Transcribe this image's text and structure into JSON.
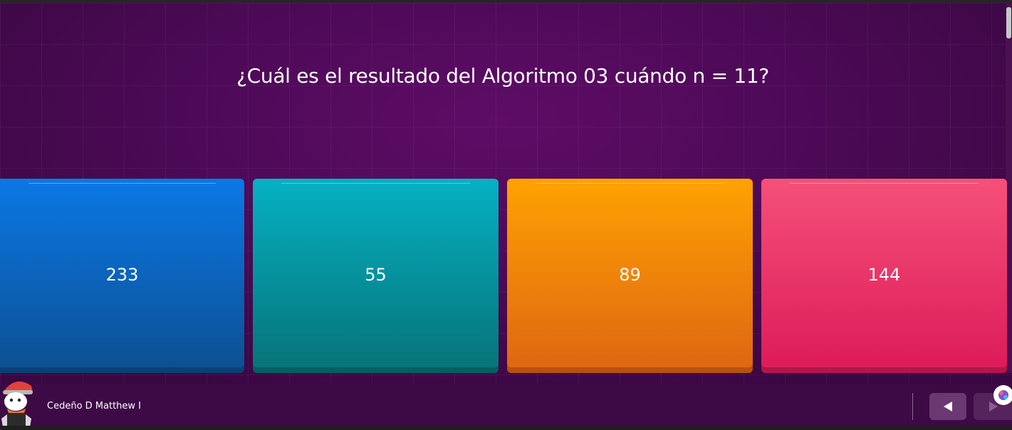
{
  "question": {
    "text": "¿Cuál es el resultado del Algoritmo 03 cuándo n = 11?"
  },
  "options": [
    {
      "label": "233",
      "color": "#0b78e6"
    },
    {
      "label": "55",
      "color": "#05b1c3"
    },
    {
      "label": "89",
      "color": "#ffa202"
    },
    {
      "label": "144",
      "color": "#f5507a"
    }
  ],
  "player": {
    "name": "Cedeño D Matthew I",
    "avatar_icon": "cartoon-avatar-icon"
  },
  "navigation": {
    "prev_icon": "triangle-left-icon",
    "next_icon": "triangle-right-icon"
  },
  "theme": {
    "background": "#4e0a58",
    "bottom_bar": "#3d0a45"
  }
}
